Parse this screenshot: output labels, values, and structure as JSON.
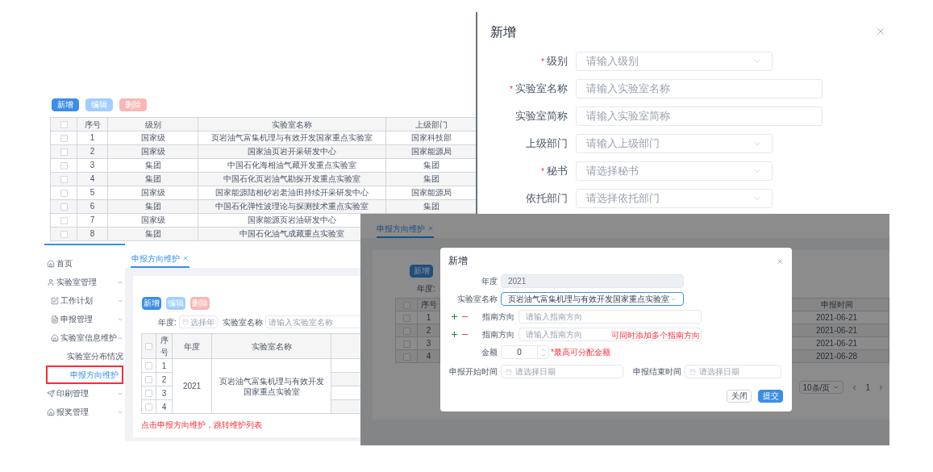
{
  "lab_table": {
    "buttons": [
      {
        "label": "新增",
        "kind": "primary"
      },
      {
        "label": "编辑",
        "kind": "edit"
      },
      {
        "label": "删除",
        "kind": "delete"
      }
    ],
    "all_checked": false,
    "columns": [
      "序号",
      "级别",
      "实验室名称",
      "上级部门"
    ],
    "rows": [
      {
        "checked": false,
        "cells": [
          "1",
          "国家级",
          "页岩油气富集机理与有效开发国家重点实验室",
          "国家科技部"
        ]
      },
      {
        "checked": false,
        "cells": [
          "2",
          "国家级",
          "国家油页岩开采研发中心",
          "国家能源局"
        ]
      },
      {
        "checked": false,
        "cells": [
          "3",
          "集团",
          "中国石化海相油气藏开发重点实验室",
          "集团"
        ]
      },
      {
        "checked": false,
        "cells": [
          "4",
          "集团",
          "中国石化页岩油气勘探开发重点实验室",
          "集团"
        ]
      },
      {
        "checked": false,
        "cells": [
          "5",
          "国家级",
          "国家能源陆相砂岩老油田持续开采研发中心",
          "国家能源局"
        ]
      },
      {
        "checked": false,
        "cells": [
          "6",
          "集团",
          "中国石化弹性波理论与探测技术重点实验室",
          "集团"
        ]
      },
      {
        "checked": false,
        "cells": [
          "7",
          "国家级",
          "国家能源页岩油研发中心"
        ]
      },
      {
        "checked": false,
        "cells": [
          "8",
          "集团",
          "中国石化油气成藏重点实验室"
        ]
      }
    ]
  },
  "lab_form": {
    "title": "新增",
    "required_mark": "*",
    "fields": [
      {
        "label": "级别",
        "required": true,
        "placeholder": "请输入级别",
        "kind": "select"
      },
      {
        "label": "实验室名称",
        "required": true,
        "placeholder": "请输入实验室名称",
        "kind": "input"
      },
      {
        "label": "实验室简称",
        "required": false,
        "placeholder": "请输入实验室简称",
        "kind": "input"
      },
      {
        "label": "上级部门",
        "required": false,
        "placeholder": "请输入上级部门",
        "kind": "select"
      },
      {
        "label": "秘书",
        "required": true,
        "placeholder": "请选择秘书",
        "kind": "select"
      },
      {
        "label": "依托部门",
        "required": false,
        "placeholder": "请选择依托部门",
        "kind": "select"
      }
    ]
  },
  "app": {
    "sidebar": [
      {
        "label": "首页",
        "selected": false
      },
      {
        "label": "实验室管理",
        "selected": false,
        "expanded": true,
        "children": [
          {
            "label": "工作计划",
            "selected": false,
            "expanded": false
          },
          {
            "label": "申报管理",
            "selected": false,
            "expanded": false
          },
          {
            "label": "实验室信息维护",
            "selected": false,
            "expanded": true,
            "children": [
              {
                "label": "实验室分布情况",
                "selected": false
              },
              {
                "label": "申报方向维护",
                "selected": true
              }
            ]
          }
        ]
      },
      {
        "label": "印刷管理",
        "selected": false,
        "expanded": false
      },
      {
        "label": "报奖管理",
        "selected": false,
        "expanded": false
      }
    ],
    "tab": {
      "label": "申报方向维护",
      "selected": true
    },
    "buttons": [
      {
        "label": "新增",
        "kind": "primary"
      },
      {
        "label": "编辑",
        "kind": "edit"
      },
      {
        "label": "删除",
        "kind": "delete"
      }
    ],
    "filters": [
      {
        "label": "年度:",
        "placeholder": "选择年",
        "kind": "year"
      },
      {
        "label": "实验室名称",
        "placeholder": "请输入实验室名称",
        "kind": "select"
      }
    ],
    "table": {
      "all_checked": false,
      "columns": [
        "序号",
        "年度",
        "实验室名称"
      ],
      "rows": [
        {
          "no": "1",
          "checked": false
        },
        {
          "no": "2",
          "checked": false
        },
        {
          "no": "3",
          "checked": false
        },
        {
          "no": "4",
          "checked": false
        }
      ],
      "year": "2021",
      "name": "页岩油气富集机理与有效开发国家重点实验室"
    },
    "note": "点击申报方向维护，跳转维护列表"
  },
  "modal_screen": {
    "tab": {
      "label": "申报方向维护",
      "selected": true
    },
    "button": {
      "label": "新增",
      "kind": "primary"
    },
    "filter_label": "年度:",
    "all_checked": false,
    "columns": [
      "序号",
      "申报时间"
    ],
    "rows": [
      {
        "no": "1",
        "date": "2021-06-21",
        "checked": false
      },
      {
        "no": "2",
        "date": "2021-06-21",
        "checked": false
      },
      {
        "no": "3",
        "date": "2021-06-21",
        "checked": false
      },
      {
        "no": "4",
        "date": "2021-06-28",
        "checked": false
      }
    ],
    "page_size": "10条/页",
    "page": "1",
    "modal": {
      "title": "新增",
      "fields": [
        {
          "label": "年度",
          "kind": "text",
          "value": "2021",
          "disabled": true
        },
        {
          "label": "实验室名称",
          "kind": "select",
          "value": "页岩油气富集机理与有效开发国家重点实验室",
          "disabled": false
        },
        {
          "label": "指南方向",
          "kind": "guide",
          "placeholder": "请输入指南方向",
          "disabled": false
        },
        {
          "label": "指南方向",
          "kind": "guide",
          "placeholder": "请输入指南方向",
          "note": "可同时添加多个指南方向",
          "disabled": false
        },
        {
          "label": "金额",
          "kind": "number",
          "value": "0",
          "note": "*最高可分配金额",
          "disabled": false
        }
      ],
      "dates": [
        {
          "label": "申报开始时间",
          "placeholder": "请选择日期"
        },
        {
          "label": "申报结束时间",
          "placeholder": "请选择日期"
        }
      ],
      "buttons": [
        {
          "label": "关闭",
          "kind": "default"
        },
        {
          "label": "提交",
          "kind": "primary"
        }
      ]
    }
  }
}
